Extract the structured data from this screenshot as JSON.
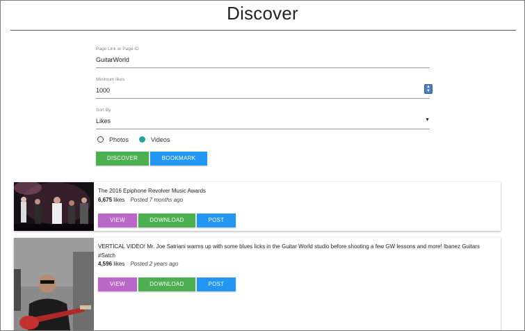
{
  "page": {
    "title": "Discover"
  },
  "form": {
    "page_link": {
      "label": "Page Link or Page ID",
      "value": "GuitarWorld"
    },
    "min_likes": {
      "label": "Minimum likes",
      "value": "1000"
    },
    "sort_by": {
      "label": "Sort By",
      "value": "Likes"
    },
    "media_type": {
      "options": [
        "Photos",
        "Videos"
      ],
      "selected": "Videos"
    },
    "discover_label": "DISCOVER",
    "bookmark_label": "BOOKMARK"
  },
  "results": [
    {
      "title": "The 2016 Epiphone Revolver Music Awards",
      "likes": "6,675",
      "likes_suffix": "likes",
      "posted": "Posted 7 months ago",
      "buttons": {
        "view": "VIEW",
        "download": "DOWNLOAD",
        "post": "POST"
      }
    },
    {
      "title": "VERTICAL VIDEO! Mr. Joe Satriani warms up with some blues licks in the Guitar World studio before shooting a few GW lessons and more! Ibanez Guitars #Satch",
      "likes": "4,596",
      "likes_suffix": "likes",
      "posted": "Posted 2 years ago",
      "buttons": {
        "view": "VIEW",
        "download": "DOWNLOAD",
        "post": "POST"
      }
    }
  ],
  "colors": {
    "discover_green": "#4caf50",
    "bookmark_blue": "#2196f3",
    "view_purple": "#ba68c8",
    "radio_teal": "#26a69a"
  }
}
